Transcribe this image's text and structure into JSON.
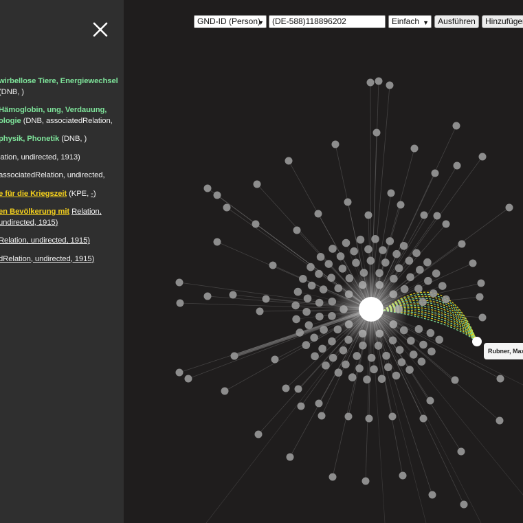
{
  "toolbar": {
    "id_type": "GND-ID (Person)",
    "id_value": "(DE-588)118896202",
    "mode": "Einfach",
    "run_label": "Ausführen",
    "add_label": "Hinzufügen"
  },
  "sidebar": {
    "entries": [
      {
        "parts": [
          {
            "t": "wirbellose Tiere,",
            "s": "kw"
          },
          {
            "t": " ",
            "s": ""
          },
          {
            "t": "Energiewechsel",
            "s": "kw"
          },
          {
            "t": " (DNB, )",
            "s": ""
          }
        ]
      },
      {
        "parts": [
          {
            "t": "Hämoglobin, ung, Verdauung, ologie",
            "s": "kw"
          },
          {
            "t": " (DNB, associatedRelation,",
            "s": ""
          }
        ]
      },
      {
        "parts": [
          {
            "t": "physik, Phonetik",
            "s": "kw"
          },
          {
            "t": " (DNB, )",
            "s": ""
          }
        ]
      },
      {
        "parts": [
          {
            "t": "lation, undirected, 1913)",
            "s": ""
          }
        ]
      },
      {
        "parts": [
          {
            "t": "associatedRelation, undirected,",
            "s": ""
          }
        ]
      },
      {
        "parts": [
          {
            "t": "e für die Kriegszeit",
            "s": "yl"
          },
          {
            "t": " (KPE, ",
            "s": ""
          },
          {
            "t": "-)",
            "s": "ul"
          }
        ]
      },
      {
        "parts": [
          {
            "t": "en Bevölkerung mit",
            "s": "yl"
          },
          {
            "t": " ",
            "s": ""
          },
          {
            "t": "Relation, undirected, 1915)",
            "s": "ul"
          }
        ]
      },
      {
        "parts": [
          {
            "t": "Relation, undirected, 1915)",
            "s": "ul"
          }
        ]
      },
      {
        "parts": [
          {
            "t": "dRelation, undirected, 1915)",
            "s": "ul"
          }
        ]
      }
    ]
  },
  "graph": {
    "selected_node_label": "Rubner, Max",
    "highlight_colors": [
      "#e8d21a",
      "#7ee39a"
    ]
  }
}
